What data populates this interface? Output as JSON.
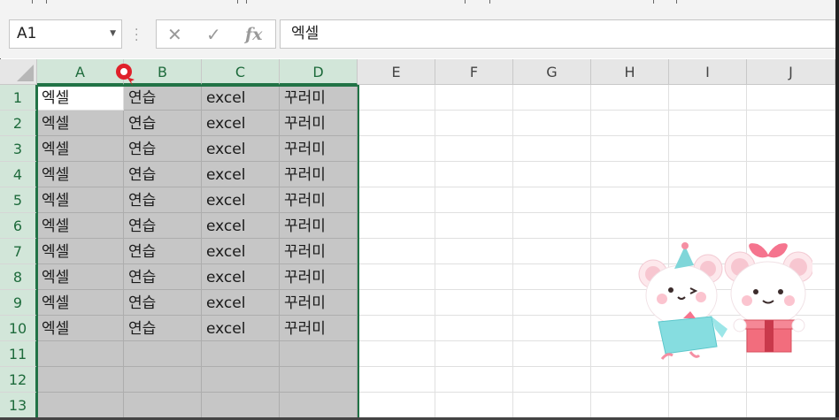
{
  "formula_bar": {
    "name_box": "A1",
    "cancel_icon": "✕",
    "enter_icon": "✓",
    "fx_label": "fx",
    "formula": "엑셀"
  },
  "columns": [
    "A",
    "B",
    "C",
    "D",
    "E",
    "F",
    "G",
    "H",
    "I",
    "J"
  ],
  "rows": [
    "1",
    "2",
    "3",
    "4",
    "5",
    "6",
    "7",
    "8",
    "9",
    "10",
    "11",
    "12",
    "13"
  ],
  "cells": [
    [
      "엑셀",
      "연습",
      "excel",
      "꾸러미"
    ],
    [
      "엑셀",
      "연습",
      "excel",
      "꾸러미"
    ],
    [
      "엑셀",
      "연습",
      "excel",
      "꾸러미"
    ],
    [
      "엑셀",
      "연습",
      "excel",
      "꾸러미"
    ],
    [
      "엑셀",
      "연습",
      "excel",
      "꾸러미"
    ],
    [
      "엑셀",
      "연습",
      "excel",
      "꾸러미"
    ],
    [
      "엑셀",
      "연습",
      "excel",
      "꾸러미"
    ],
    [
      "엑셀",
      "연습",
      "excel",
      "꾸러미"
    ],
    [
      "엑셀",
      "연습",
      "excel",
      "꾸러미"
    ],
    [
      "엑셀",
      "연습",
      "excel",
      "꾸러미"
    ]
  ],
  "selection": {
    "range": "A1:D13",
    "active_cell": "A1"
  },
  "colors": {
    "accent": "#217346",
    "selection_fill": "#c6c6c6",
    "pointer": "#e0202a"
  },
  "decoration": "two-mice-gift-illustration"
}
